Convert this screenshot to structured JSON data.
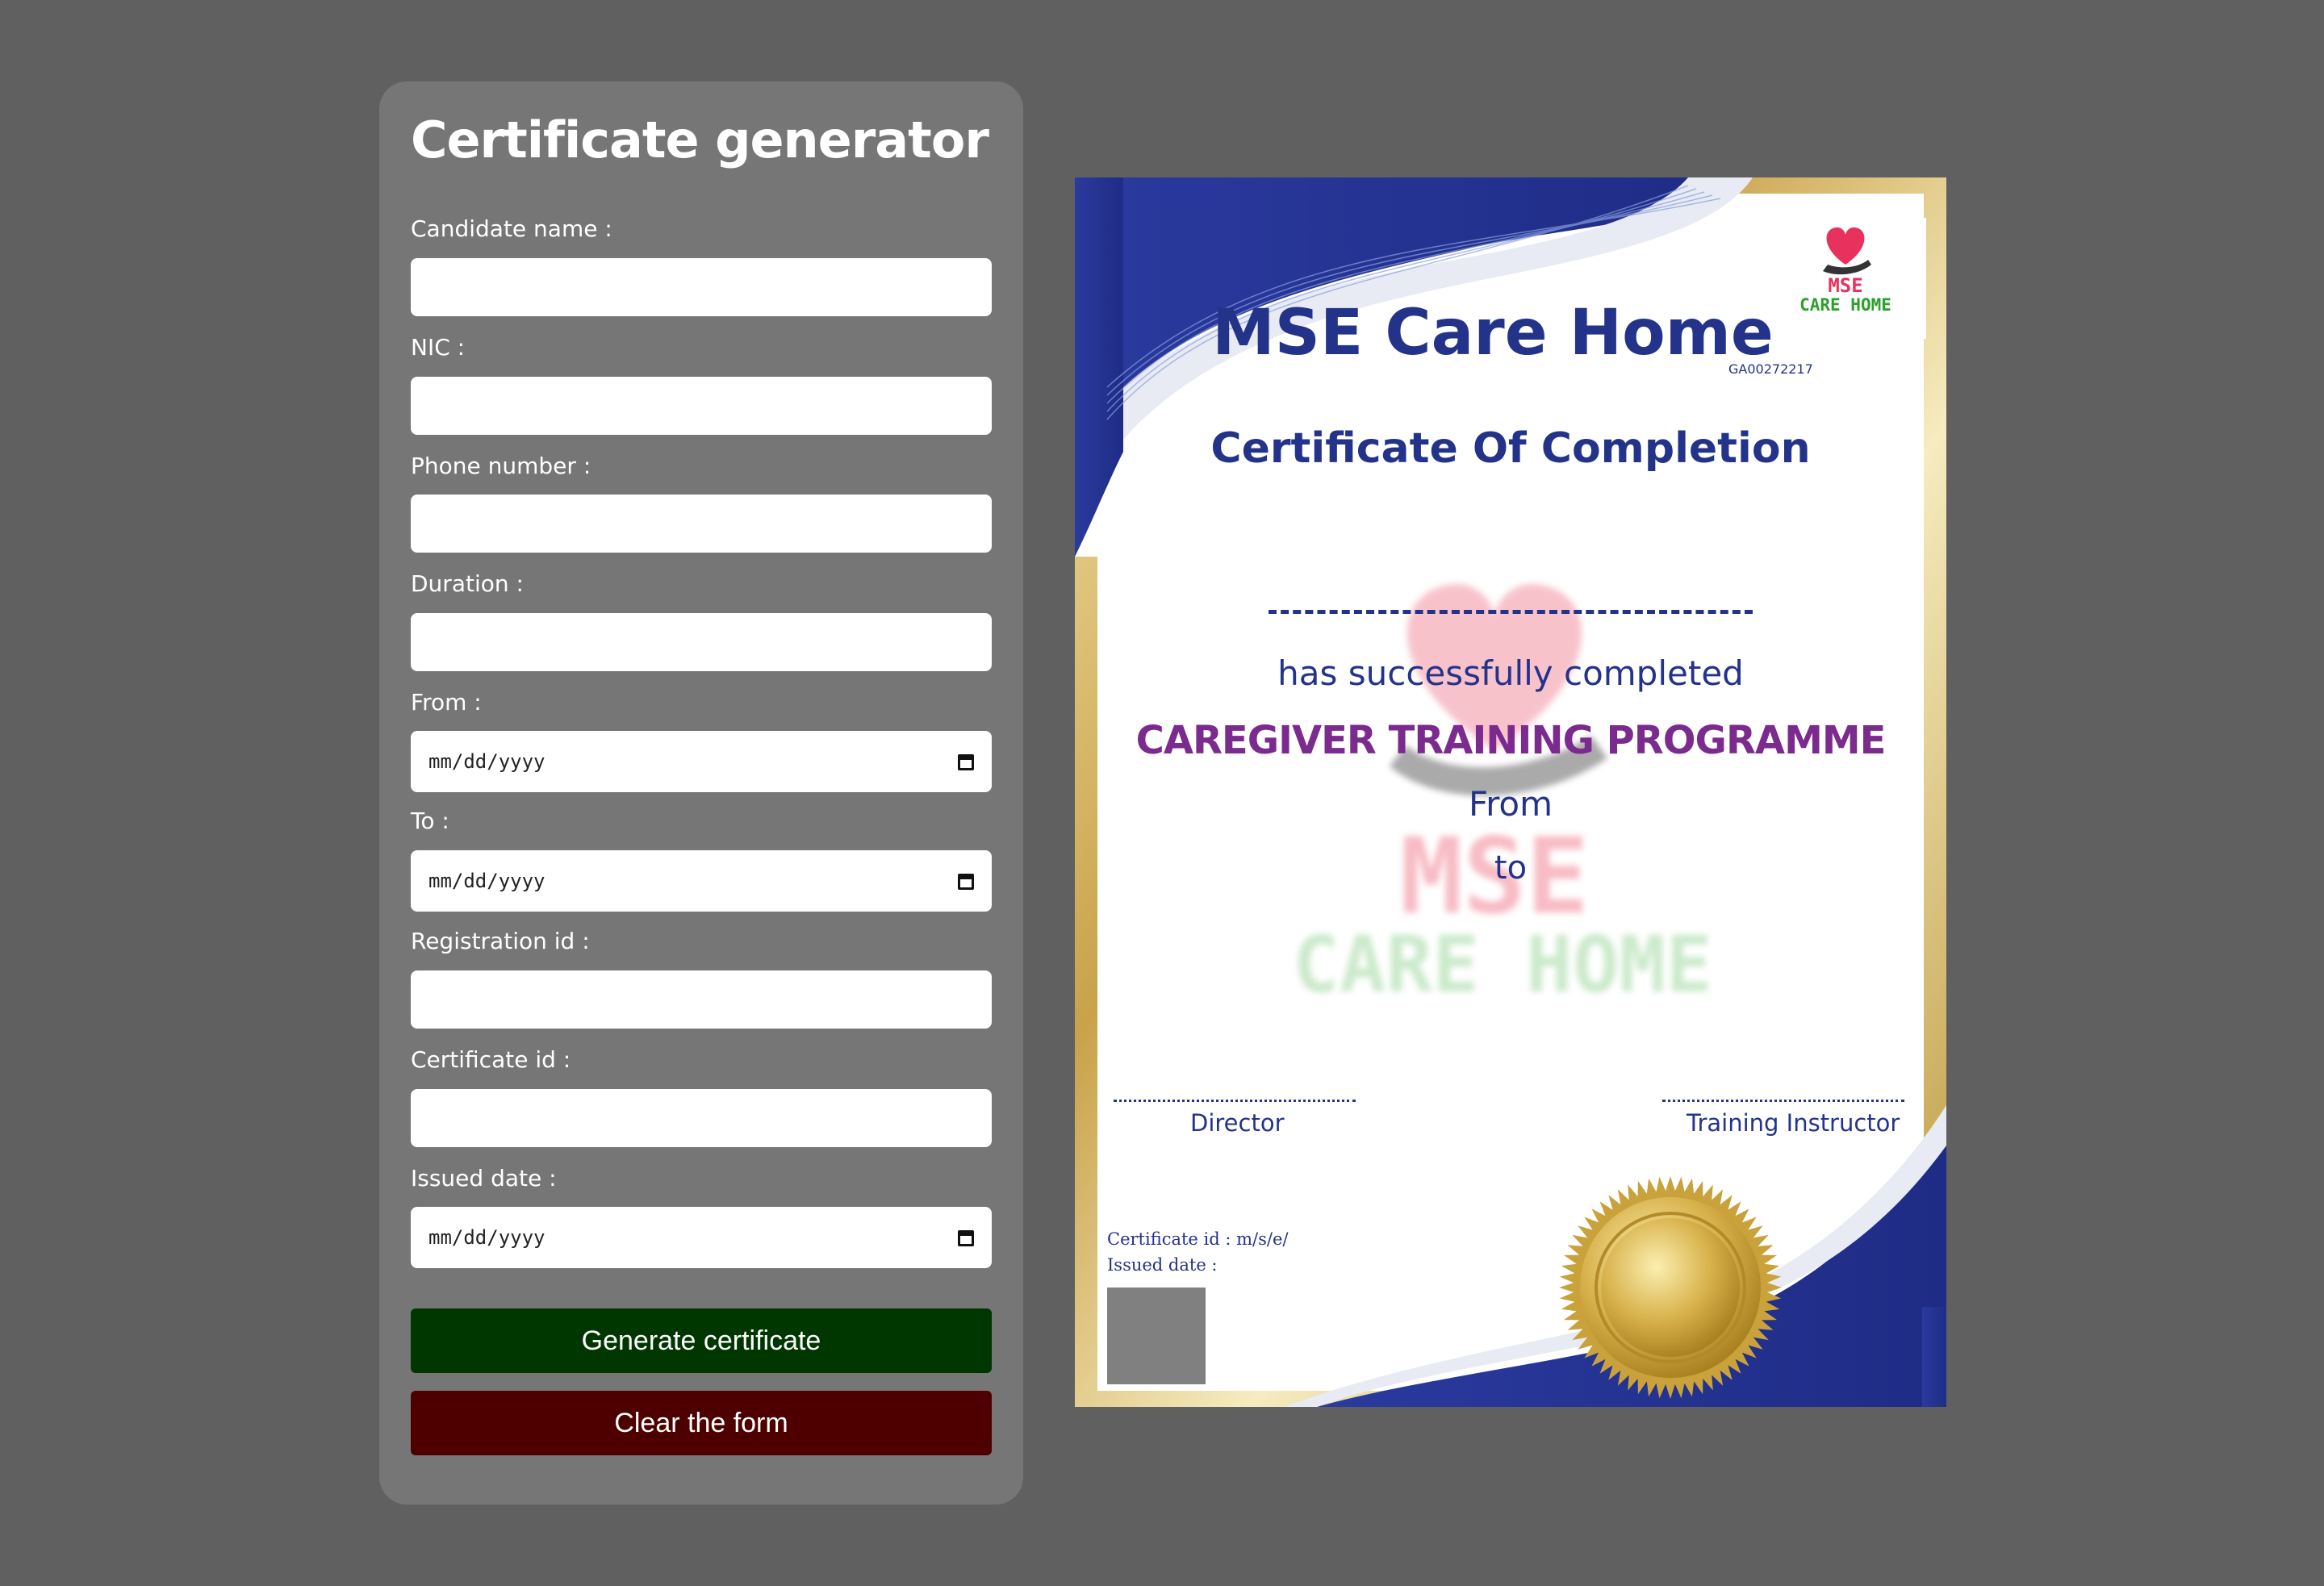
{
  "form": {
    "title": "Certificate generator",
    "fields": [
      {
        "label": "Candidate name :",
        "value": ""
      },
      {
        "label": "NIC :",
        "value": ""
      },
      {
        "label": "Phone number :",
        "value": ""
      },
      {
        "label": "Duration :",
        "value": ""
      },
      {
        "label": "From :",
        "placeholder": "mm/dd/yyyy"
      },
      {
        "label": "To :",
        "placeholder": "mm/dd/yyyy"
      },
      {
        "label": "Registration id :",
        "value": ""
      },
      {
        "label": "Certificate id :",
        "value": ""
      },
      {
        "label": "Issued date :",
        "placeholder": "mm/dd/yyyy"
      }
    ],
    "generate_label": "Generate certificate",
    "clear_label": "Clear the form",
    "generate_color": "#003600",
    "clear_color": "#4e0000"
  },
  "certificate": {
    "logo_mse": "MSE",
    "logo_care": "CARE HOME",
    "org_name": "MSE Care Home",
    "reg_code": "GA00272217",
    "title": "Certificate Of Completion",
    "completed_text": "has successfully completed",
    "programme": "CAREGIVER TRAINING PROGRAMME",
    "from_label": "From",
    "to_label": "to",
    "watermark_mse": "MSE",
    "watermark_care": "CARE HOME",
    "signatory_left": "Director",
    "signatory_right": "Training Instructor",
    "certificate_id_label": "Certificate id :",
    "certificate_id_value": "m/s/e/",
    "issued_date_label": "Issued date :",
    "colors": {
      "primary": "#24338a",
      "programme": "#7b2a8e",
      "gold": "#d4b35a"
    }
  }
}
